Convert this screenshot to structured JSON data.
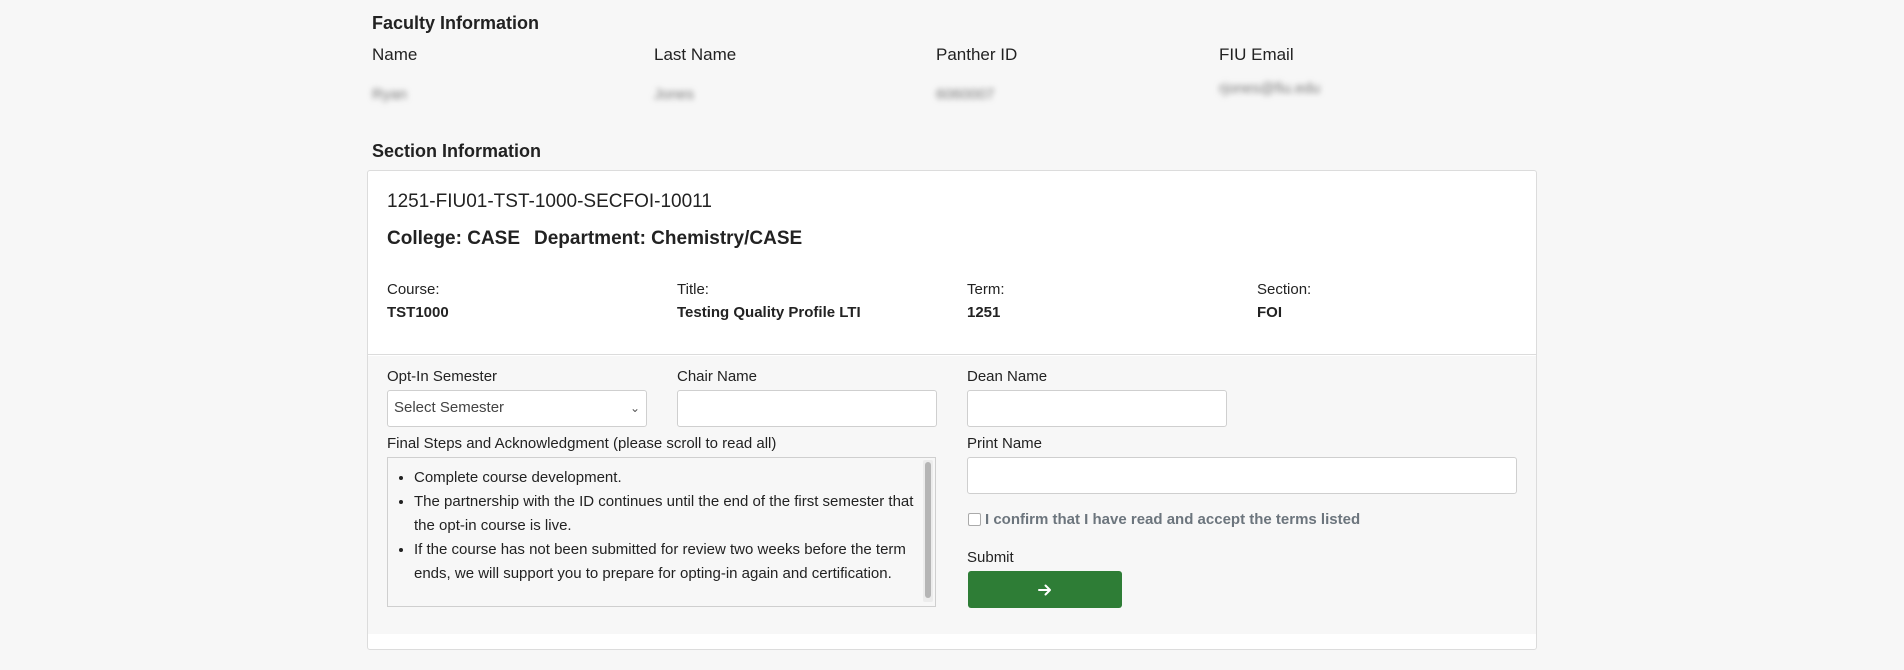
{
  "faculty": {
    "heading": "Faculty Information",
    "columns": [
      "Name",
      "Last Name",
      "Panther ID",
      "FIU Email"
    ],
    "values": [
      "Ryan",
      "Jones",
      "6060007",
      "rjones@fiu.edu"
    ]
  },
  "section": {
    "heading": "Section Information",
    "code": "1251-FIU01-TST-1000-SECFOI-10011",
    "college": "College: CASE",
    "department": "Department: Chemistry/CASE",
    "fields": [
      {
        "label": "Course:",
        "value": "TST1000"
      },
      {
        "label": "Title:",
        "value": "Testing Quality Profile LTI"
      },
      {
        "label": "Term:",
        "value": "1251"
      },
      {
        "label": "Section:",
        "value": "FOI"
      }
    ]
  },
  "form": {
    "opt_in_label": "Opt-In Semester",
    "opt_in_selected": "Select Semester",
    "chair_label": "Chair Name",
    "dean_label": "Dean Name",
    "terms_label": "Final Steps and Acknowledgment (please scroll to read all)",
    "terms_items": [
      "Complete course development.",
      "The partnership with the ID continues until the end of the first semester that the opt-in course is live.",
      "If the course has not been submitted for review two weeks before the term ends, we will support you to prepare for opting-in again and certification."
    ],
    "print_name_label": "Print Name",
    "confirm_label": "I confirm that I have read and accept the terms listed",
    "submit_label": "Submit",
    "submit_icon": "arrow-right-icon",
    "accent_color": "#2e7d36"
  }
}
